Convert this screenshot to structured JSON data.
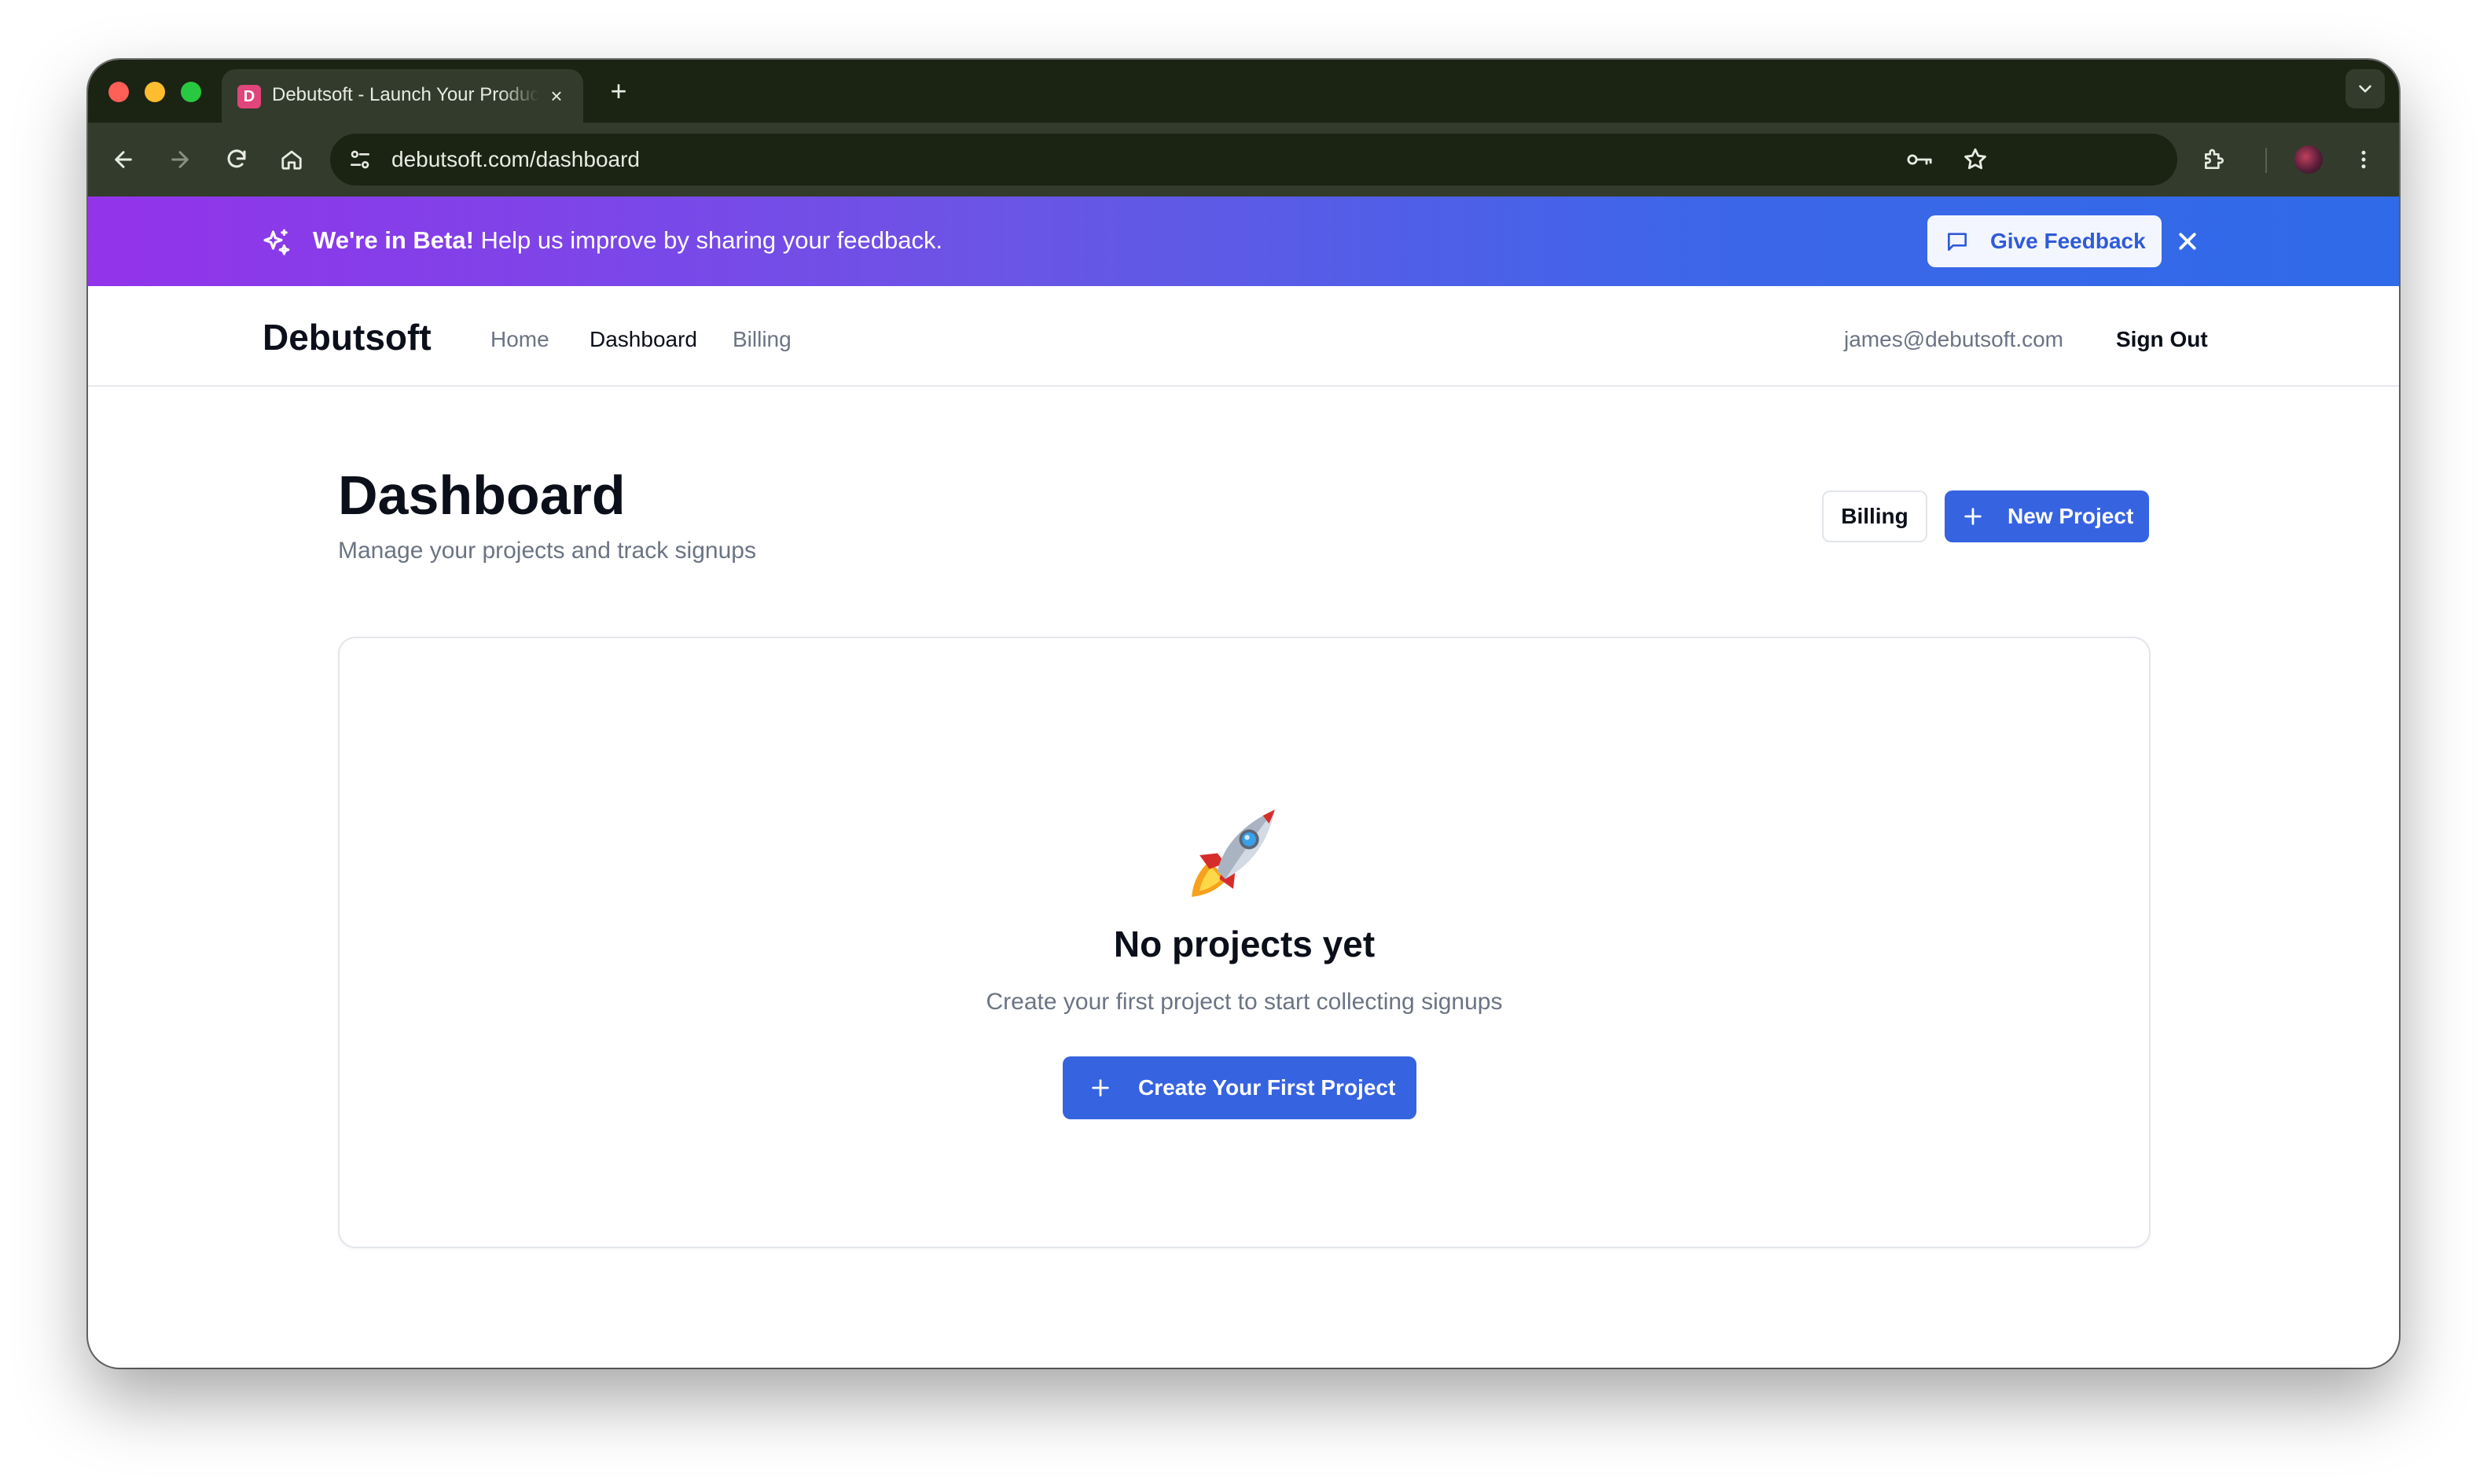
{
  "browser": {
    "tab": {
      "title": "Debutsoft - Launch Your Product",
      "favicon_letter": "D",
      "close_label": "×"
    },
    "new_tab_label": "+",
    "url": "debutsoft.com/dashboard",
    "colors": {
      "tab_strip": "#1b2313",
      "toolbar": "#333b2c"
    }
  },
  "banner": {
    "bold_text": "We're in Beta!",
    "text": " Help us improve by sharing your feedback.",
    "feedback_label": "Give Feedback",
    "icon": "sparkles-icon",
    "colors": {
      "gradient_start": "#9333ea",
      "gradient_end": "#2f6ae8"
    }
  },
  "nav": {
    "brand": "Debutsoft",
    "links": [
      {
        "label": "Home",
        "active": false
      },
      {
        "label": "Dashboard",
        "active": true
      },
      {
        "label": "Billing",
        "active": false
      }
    ],
    "email": "james@debutsoft.com",
    "sign_out": "Sign Out"
  },
  "main": {
    "title": "Dashboard",
    "subtitle": "Manage your projects and track signups",
    "billing_button": "Billing",
    "new_project_button": "New Project",
    "accent_color": "#3663e0"
  },
  "empty_state": {
    "icon": "rocket-icon",
    "title": "No projects yet",
    "subtitle": "Create your first project to start collecting signups",
    "cta_label": "Create Your First Project"
  }
}
